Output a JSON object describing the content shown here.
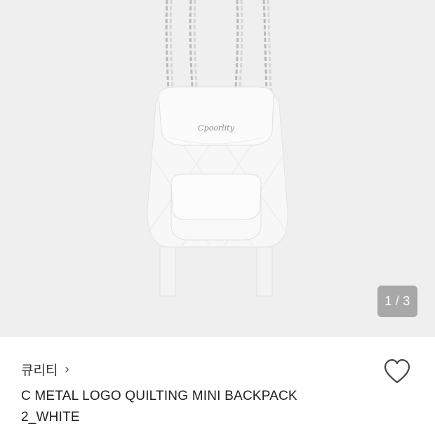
{
  "gallery": {
    "current": "1",
    "separator": "/",
    "total": "3",
    "product_logo_text": "Cpoorlity"
  },
  "product": {
    "brand": "큐리티",
    "brand_chevron": "›",
    "title_line1": "C METAL LOGO QUILTING MINI BACKPACK",
    "title_line2": "2_WHITE"
  },
  "icons": {
    "wishlist": "heart-outline-icon",
    "brand_link": "chevron-right-icon"
  },
  "colors": {
    "gallery_bg": "#efefef",
    "text": "#222222",
    "counter_bg": "#6e6e6e"
  }
}
